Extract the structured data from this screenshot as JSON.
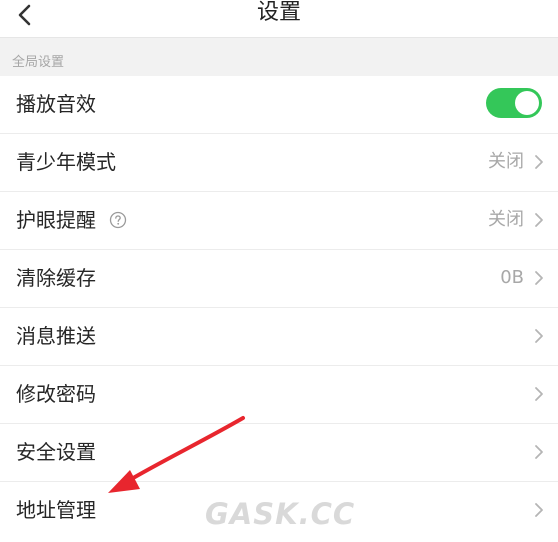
{
  "header": {
    "title": "设置",
    "back_icon": "chevron-left-icon"
  },
  "section": {
    "label": "全局设置"
  },
  "items": [
    {
      "label": "播放音效",
      "type": "toggle",
      "toggle_on": true
    },
    {
      "label": "青少年模式",
      "value": "关闭"
    },
    {
      "label": "护眼提醒",
      "value": "关闭",
      "help_icon": "question-circle-icon"
    },
    {
      "label": "清除缓存",
      "value": "0B"
    },
    {
      "label": "消息推送",
      "value": ""
    },
    {
      "label": "修改密码",
      "value": ""
    },
    {
      "label": "安全设置",
      "value": ""
    },
    {
      "label": "地址管理",
      "value": ""
    }
  ],
  "watermark": "GASK.CC",
  "colors": {
    "toggle_on": "#34c759",
    "annotation_arrow": "#e8262e",
    "page_bg": "#f2f2f2"
  }
}
